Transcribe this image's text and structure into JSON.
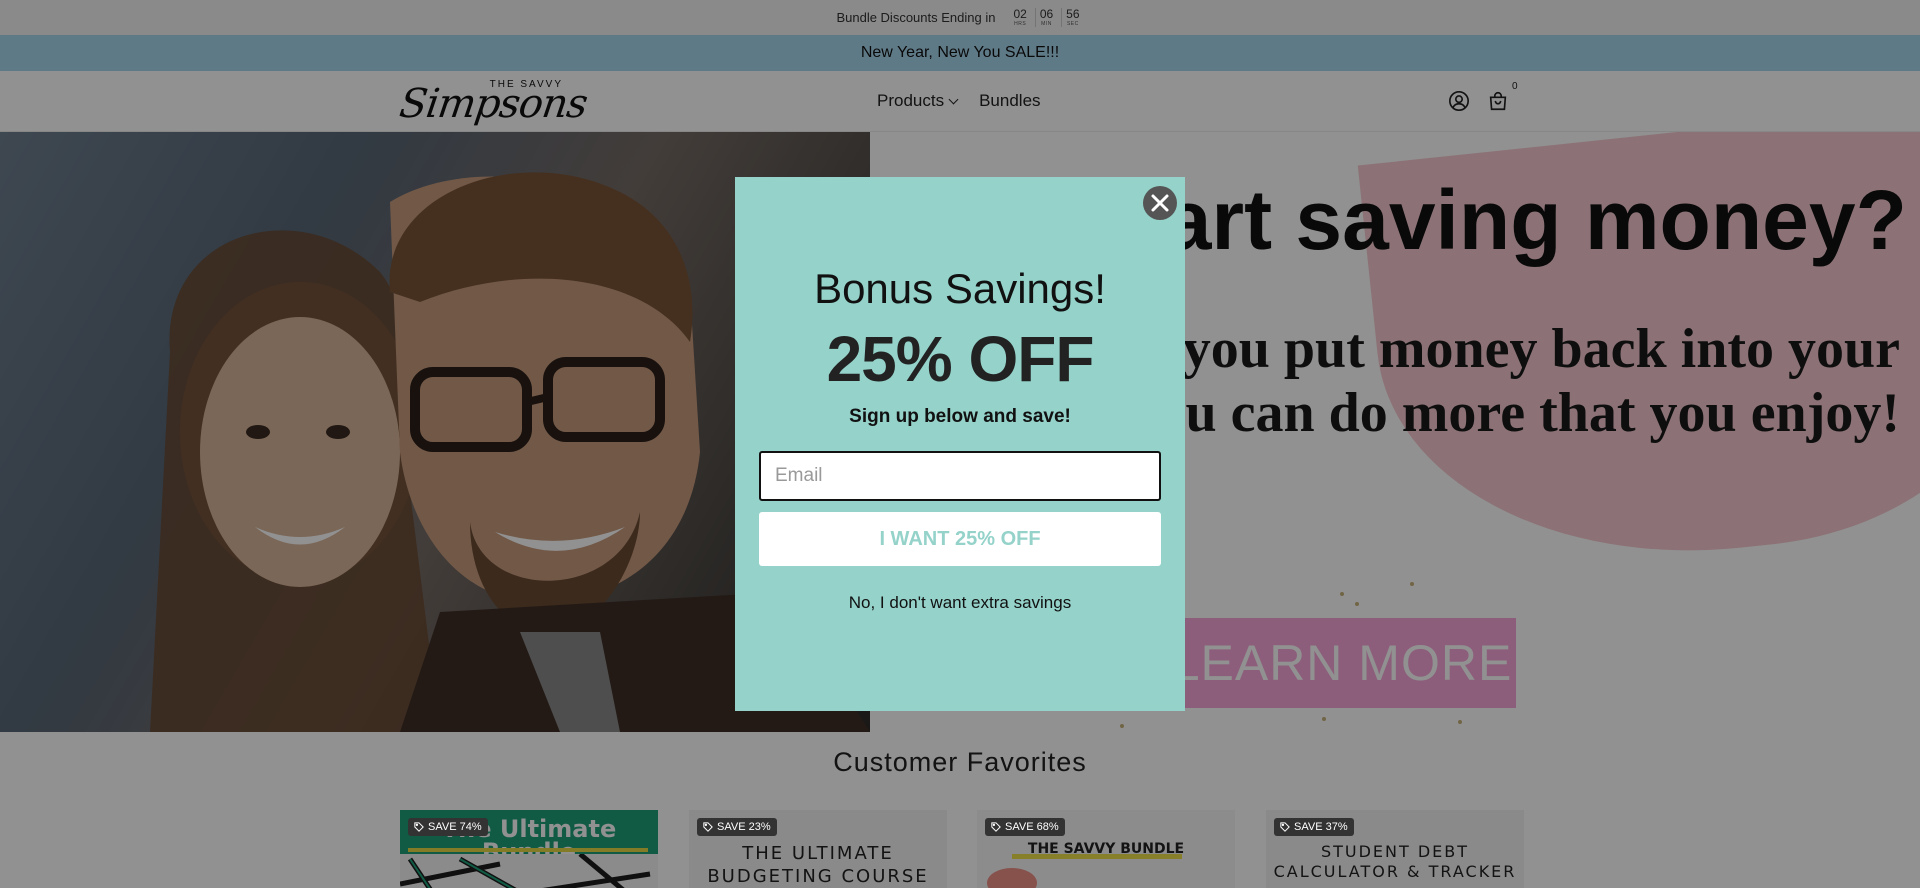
{
  "countdown": {
    "label": "Bundle Discounts Ending in",
    "units": [
      {
        "value": "02",
        "label": "HRS"
      },
      {
        "value": "06",
        "label": "MIN"
      },
      {
        "value": "56",
        "label": "SEC"
      }
    ]
  },
  "announcement": {
    "text": "New Year, New You SALE!!!"
  },
  "header": {
    "logo_small": "THE SAVVY",
    "logo_script": "Simpsons",
    "nav": [
      {
        "label": "Products",
        "has_dropdown": true
      },
      {
        "label": "Bundles",
        "has_dropdown": false
      }
    ],
    "cart_count": "0"
  },
  "hero": {
    "title": "start saving money?",
    "subtitle_line1": "you put money back into your",
    "subtitle_line2": "ou can do more that you enjoy!",
    "cta": "LEARN MORE"
  },
  "favorites": {
    "title": "Customer Favorites",
    "products": [
      {
        "badge": "SAVE 74%",
        "title": "The Ultimate Bundle"
      },
      {
        "badge": "SAVE 23%",
        "title_line1": "THE ULTIMATE",
        "title_line2": "BUDGETING COURSE"
      },
      {
        "badge": "SAVE 68%",
        "title": "THE SAVVY BUNDLE"
      },
      {
        "badge": "SAVE 37%",
        "title_line1": "STUDENT DEBT",
        "title_line2": "CALCULATOR & TRACKER"
      }
    ]
  },
  "modal": {
    "heading": "Bonus Savings!",
    "offer": "25% OFF",
    "subheading": "Sign up below and save!",
    "email_placeholder": "Email",
    "submit_label": "I WANT 25% OFF",
    "decline_label": "No, I don't want extra savings"
  },
  "colors": {
    "modal_bg": "#94d2ca",
    "announcement_bg": "#a8d6ee",
    "hero_cta_bg": "#f6a6d8",
    "hero_blob": "#f6c9cf"
  }
}
